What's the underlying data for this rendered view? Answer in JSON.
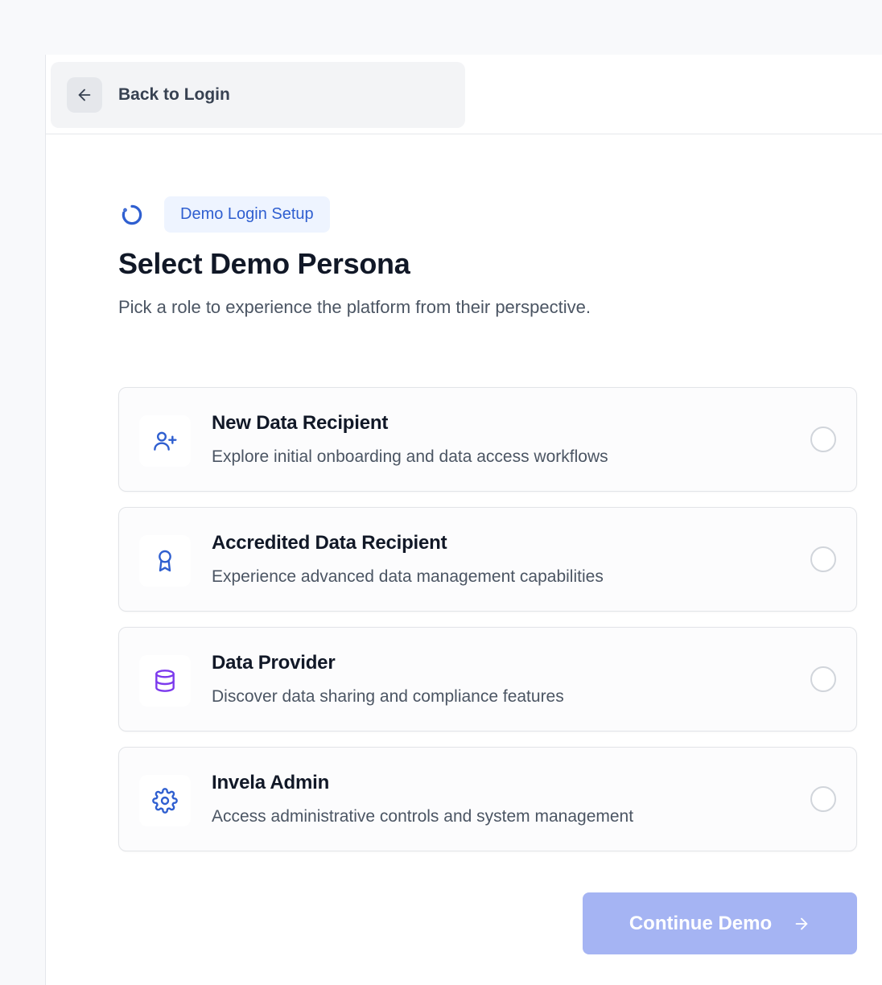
{
  "header": {
    "back_label": "Back to Login",
    "back_icon": "arrow-left-icon"
  },
  "intro": {
    "tag_icon": "loading-spinner-icon",
    "tag_label": "Demo Login Setup",
    "title": "Select Demo Persona",
    "subtitle": "Pick a role to experience the platform from their perspective."
  },
  "personas": [
    {
      "title": "New Data Recipient",
      "description": "Explore initial onboarding and data access workflows",
      "icon": "user-plus-icon",
      "icon_color": "#2f5fd0",
      "selected": false
    },
    {
      "title": "Accredited Data Recipient",
      "description": "Experience advanced data management capabilities",
      "icon": "award-icon",
      "icon_color": "#2f5fd0",
      "selected": false
    },
    {
      "title": "Data Provider",
      "description": "Discover data sharing and compliance features",
      "icon": "database-icon",
      "icon_color": "#7c3aed",
      "selected": false
    },
    {
      "title": "Invela Admin",
      "description": "Access administrative controls and system management",
      "icon": "gear-icon",
      "icon_color": "#2f5fd0",
      "selected": false
    }
  ],
  "footer": {
    "continue_label": "Continue Demo",
    "continue_icon": "arrow-right-icon",
    "continue_disabled": true
  },
  "colors": {
    "accent": "#2f5fd0",
    "button_disabled": "#a5b4f3",
    "tag_bg": "#eef4ff"
  }
}
